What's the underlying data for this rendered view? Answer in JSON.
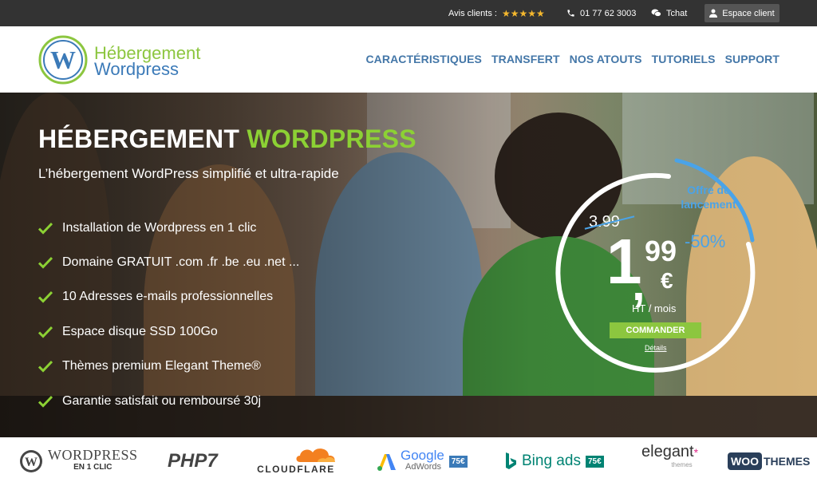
{
  "topbar": {
    "avis_label": "Avis clients :",
    "stars": [
      "★",
      "★",
      "★",
      "★",
      "★"
    ],
    "phone": "01 77 62 3003",
    "chat": "Tchat",
    "espace_client": "Espace client"
  },
  "logo": {
    "line1": "Hébergement",
    "line2": "Wordpress",
    "mark": "W"
  },
  "nav": [
    "CARACTÉRISTIQUES",
    "TRANSFERT",
    "NOS ATOUTS",
    "TUTORIELS",
    "SUPPORT"
  ],
  "hero": {
    "title_white": "HÉBERGEMENT ",
    "title_green": "WORDPRESS",
    "subtitle": "L’hébergement WordPress simplifié et ultra-rapide",
    "features": [
      "Installation de Wordpress en 1 clic",
      "Domaine GRATUIT .com .fr .be .eu .net ...",
      "10 Adresses e-mails professionnelles",
      "Espace disque SSD 100Go",
      "Thèmes premium Elegant Theme®",
      "Garantie satisfait ou remboursé 30j"
    ]
  },
  "offer": {
    "line1": "Offre de",
    "line2": "lancement",
    "old_price": "3.99",
    "discount": "-50%",
    "price_int": "1",
    "price_comma": ",",
    "price_cents": "99",
    "currency": "€",
    "unit": "HT / mois",
    "order_button": "COMMANDER",
    "details_link": "Détails"
  },
  "partners": {
    "wordpress": "WORDPRESS",
    "wordpress_sub": "EN 1 CLIC",
    "php": "PHP7",
    "cloudflare": "CLOUDFLARE",
    "google": "Google",
    "adwords": "AdWords",
    "google_badge": "75€",
    "bing": "Bing ads",
    "bing_badge": "75€",
    "elegant": "elegant",
    "elegant_sub": "themes",
    "woo": "WOO",
    "themes": "THEMES"
  },
  "colors": {
    "brand_green": "#8cc63f",
    "brand_blue": "#3b7ab8",
    "accent_blue": "#4aa3e8",
    "topbar_bg": "#333333"
  }
}
